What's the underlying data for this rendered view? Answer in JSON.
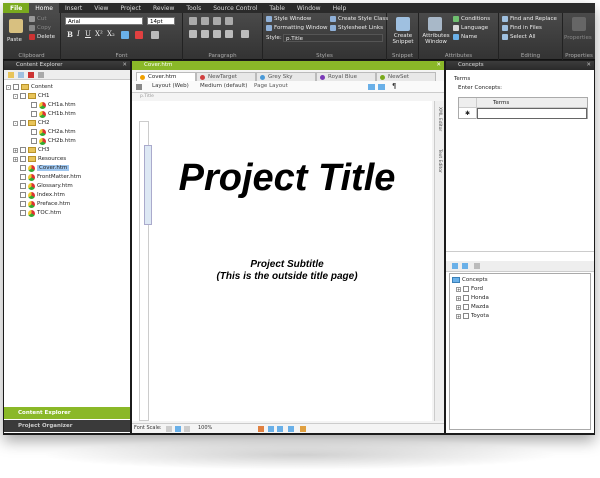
{
  "menu": {
    "file": "File",
    "items": [
      "Home",
      "Insert",
      "View",
      "Project",
      "Review",
      "Tools",
      "Source Control",
      "Table",
      "Window",
      "Help"
    ]
  },
  "ribbon": {
    "clipboard": {
      "label": "Clipboard",
      "paste": "Paste",
      "cut": "Cut",
      "copy": "Copy",
      "delete": "Delete"
    },
    "font": {
      "label": "Font",
      "family": "Arial",
      "size": "14pt"
    },
    "paragraph": {
      "label": "Paragraph"
    },
    "styles": {
      "label": "Styles",
      "style_window": "Style Window",
      "formatting_window": "Formatting Window",
      "style_prefix": "Style:",
      "style_value": "p.Title",
      "create_style_class": "Create Style Class",
      "stylesheet_links": "Stylesheet Links"
    },
    "snippet": {
      "label": "Snippet",
      "create_snippet": "Create Snippet"
    },
    "attributes": {
      "label": "Attributes",
      "attributes_window": "Attributes Window",
      "conditions": "Conditions",
      "language": "Language",
      "name": "Name"
    },
    "editing": {
      "label": "Editing",
      "find_replace": "Find and Replace",
      "find_in_files": "Find in Files",
      "select_all": "Select All"
    },
    "properties": {
      "label": "Properties",
      "properties": "Properties"
    }
  },
  "content_explorer": {
    "title": "Content Explorer",
    "items": [
      {
        "label": "Content",
        "kind": "root"
      },
      {
        "label": "CH1",
        "kind": "folder"
      },
      {
        "label": "CH1a.htm",
        "kind": "file"
      },
      {
        "label": "CH1b.htm",
        "kind": "file"
      },
      {
        "label": "CH2",
        "kind": "folder"
      },
      {
        "label": "CH2a.htm",
        "kind": "file"
      },
      {
        "label": "CH2b.htm",
        "kind": "file"
      },
      {
        "label": "CH3",
        "kind": "folder"
      },
      {
        "label": "Resources",
        "kind": "folder"
      },
      {
        "label": "Cover.htm",
        "kind": "file",
        "selected": true
      },
      {
        "label": "FrontMatter.htm",
        "kind": "file"
      },
      {
        "label": "Glossary.htm",
        "kind": "file"
      },
      {
        "label": "Index.htm",
        "kind": "file"
      },
      {
        "label": "Preface.htm",
        "kind": "file"
      },
      {
        "label": "TOC.htm",
        "kind": "file"
      }
    ],
    "bottom_tabs": [
      "Content Explorer",
      "Project Organizer"
    ]
  },
  "editor": {
    "title": "Cover.htm",
    "tabs": [
      {
        "label": "Cover.htm",
        "color": "#f0a000"
      },
      {
        "label": "NewTarget",
        "color": "#d04040"
      },
      {
        "label": "Grey Sky",
        "color": "#4a9ad8"
      },
      {
        "label": "Royal Blue",
        "color": "#7a3ab8"
      },
      {
        "label": "NewSet",
        "color": "#7aaa1e"
      }
    ],
    "toolbar": {
      "layout": "Layout (Web)",
      "medium": "Medium (default)",
      "page_layout": "Page Layout"
    },
    "breadcrumb": "p.Title",
    "side_tabs": [
      "XML Editor",
      "Text Editor"
    ],
    "doc_title": "Project Title",
    "doc_subtitle_1": "Project Subtitle",
    "doc_subtitle_2": "(This is the outside title page)",
    "status": {
      "font_scale": "Font Scale:",
      "zoom": "100%"
    }
  },
  "concepts": {
    "title": "Concepts",
    "terms_heading": "Terms",
    "enter_label": "Enter Concepts:",
    "column_header": "Terms",
    "new_row_marker": "✱",
    "tree_root": "Concepts",
    "tree_items": [
      "Ford",
      "Honda",
      "Mazda",
      "Toyota"
    ]
  },
  "colors": {
    "accent": "#7aaa1e",
    "frame": "#1b1b1b",
    "selection": "#9fc7f0"
  }
}
